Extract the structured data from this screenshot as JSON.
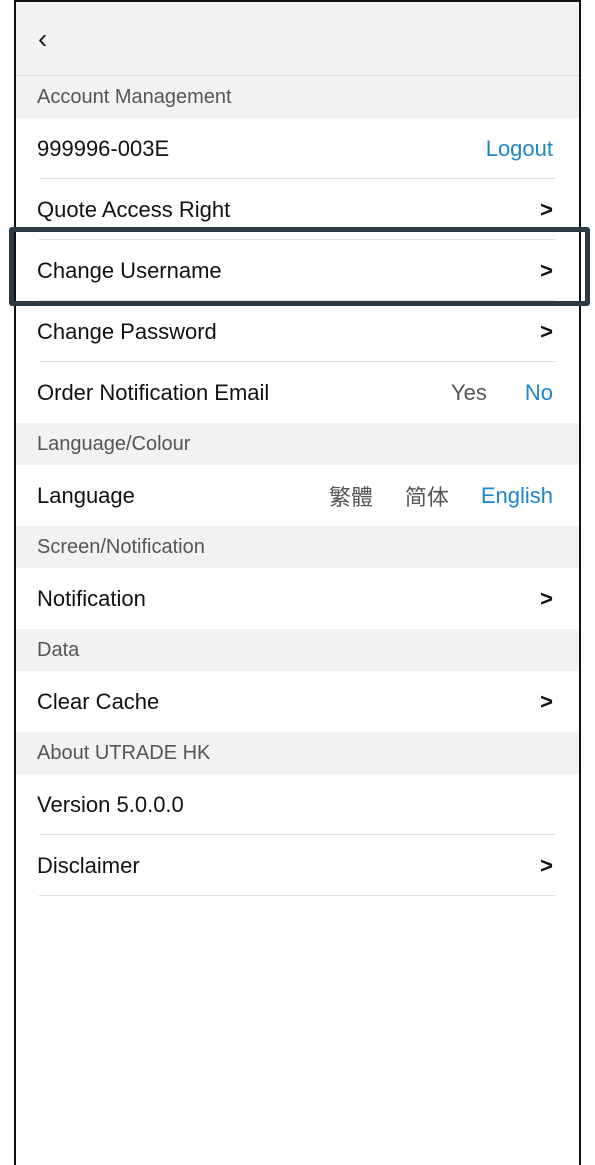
{
  "header": {
    "back_icon": "‹"
  },
  "sections": {
    "account": "Account Management",
    "language_colour": "Language/Colour",
    "screen_notification": "Screen/Notification",
    "data": "Data",
    "about": "About UTRADE HK"
  },
  "account": {
    "id": "999996-003E",
    "logout": "Logout",
    "quote_access": "Quote Access Right",
    "change_username": "Change Username",
    "change_password": "Change Password",
    "order_email": "Order Notification Email",
    "order_email_yes": "Yes",
    "order_email_no": "No"
  },
  "language": {
    "label": "Language",
    "traditional": "繁體",
    "simplified": "简体",
    "english": "English"
  },
  "notification": {
    "label": "Notification"
  },
  "data": {
    "clear_cache": "Clear Cache"
  },
  "about": {
    "version": "Version 5.0.0.0",
    "disclaimer": "Disclaimer"
  },
  "chevron": ">",
  "colors": {
    "accent": "#1d86c9",
    "highlight_border": "#2b3a44",
    "section_bg": "#f2f2f4"
  }
}
